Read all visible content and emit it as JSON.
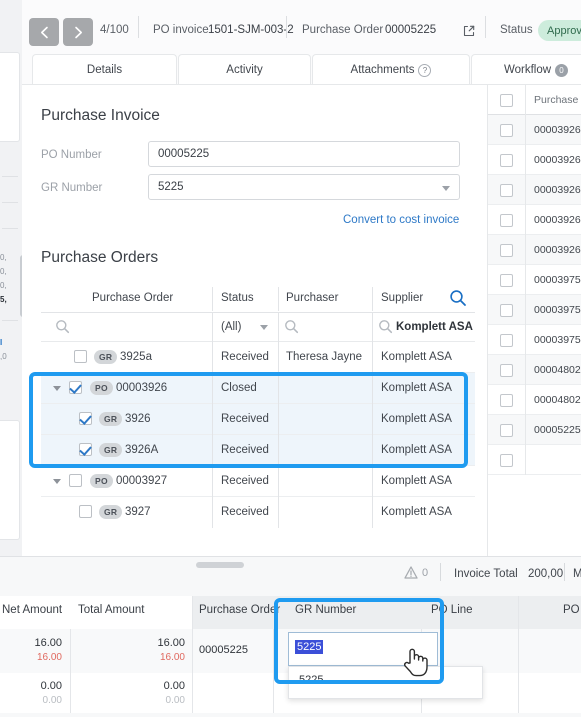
{
  "header": {
    "prev_icon": "chevron-left-icon",
    "next_icon": "chevron-right-icon",
    "page_count": "4/100",
    "doc_type_label": "PO invoice",
    "doc_number": "1501-SJM-003-2",
    "po_label": "Purchase Order",
    "po_number": "00005225",
    "external_link_icon": "external-link-icon",
    "status_label": "Status",
    "status_value": "Approved",
    "status_color": "#cdecdc"
  },
  "tabs": [
    {
      "label": "Details",
      "badge": ""
    },
    {
      "label": "Activity",
      "badge": ""
    },
    {
      "label": "Attachments",
      "badge": "?"
    },
    {
      "label": "Workflow",
      "badge": "0"
    }
  ],
  "invoice_section": {
    "title": "Purchase Invoice",
    "po_number_label": "PO Number",
    "po_number_value": "00005225",
    "gr_number_label": "GR Number",
    "gr_number_value": "5225",
    "convert_link": "Convert to cost invoice"
  },
  "purchase_orders": {
    "title": "Purchase Orders",
    "search_icon": "search-icon",
    "columns": [
      "Purchase Order",
      "Status",
      "Purchaser",
      "Supplier"
    ],
    "filters": {
      "purchase_order": "",
      "status": "(All)",
      "purchaser": "",
      "supplier": "Komplett ASA"
    },
    "rows": [
      {
        "indent": 1,
        "checked": false,
        "expander": false,
        "tag": "GR",
        "id": "3925a",
        "status": "Received",
        "purchaser": "Theresa Jayne",
        "supplier": "Komplett ASA",
        "highlighted": false
      },
      {
        "indent": 0,
        "checked": true,
        "expander": true,
        "tag": "PO",
        "id": "00003926",
        "status": "Closed",
        "purchaser": "",
        "supplier": "Komplett ASA",
        "highlighted": true
      },
      {
        "indent": 1,
        "checked": true,
        "expander": false,
        "tag": "GR",
        "id": "3926",
        "status": "Received",
        "purchaser": "",
        "supplier": "Komplett ASA",
        "highlighted": true
      },
      {
        "indent": 1,
        "checked": true,
        "expander": false,
        "tag": "GR",
        "id": "3926A",
        "status": "Received",
        "purchaser": "",
        "supplier": "Komplett ASA",
        "highlighted": true
      },
      {
        "indent": 0,
        "checked": false,
        "expander": true,
        "tag": "PO",
        "id": "00003927",
        "status": "Received",
        "purchaser": "",
        "supplier": "Komplett ASA",
        "highlighted": false
      },
      {
        "indent": 1,
        "checked": false,
        "expander": false,
        "tag": "GR",
        "id": "3927",
        "status": "Received",
        "purchaser": "",
        "supplier": "Komplett ASA",
        "highlighted": false
      }
    ],
    "highlight_color": "#1f9bf0"
  },
  "right_list": {
    "header": "Purchase Or",
    "rows": [
      "00003926",
      "00003926",
      "00003926",
      "00003926",
      "00003926",
      "00003975",
      "00003975",
      "00003975",
      "00004802",
      "00004802",
      "00005225"
    ]
  },
  "bottom": {
    "warning_icon": "warning-triangle-icon",
    "warning_count": "0",
    "invoice_total_label": "Invoice Total",
    "invoice_total_value": "200,00",
    "trailing_label": "M",
    "columns": [
      "Net Amount",
      "Total Amount",
      "Purchase Order",
      "GR Number",
      "PO Line",
      "PO"
    ],
    "rows": [
      {
        "net": "16.00",
        "net_sub": "16.00",
        "total": "16.00",
        "total_sub": "16.00",
        "purchase_order": "00005225",
        "gr_number": "",
        "po_line": ""
      },
      {
        "net": "0.00",
        "net_sub": "0.00",
        "total": "0.00",
        "total_sub": "0.00",
        "purchase_order": "",
        "gr_number": "",
        "po_line": ""
      }
    ],
    "gr_editor": {
      "selected_text": "5225",
      "dropdown_options": [
        "5225"
      ],
      "cursor_icon": "pointer-hand-cursor"
    },
    "highlight_color": "#1f9bf0"
  }
}
